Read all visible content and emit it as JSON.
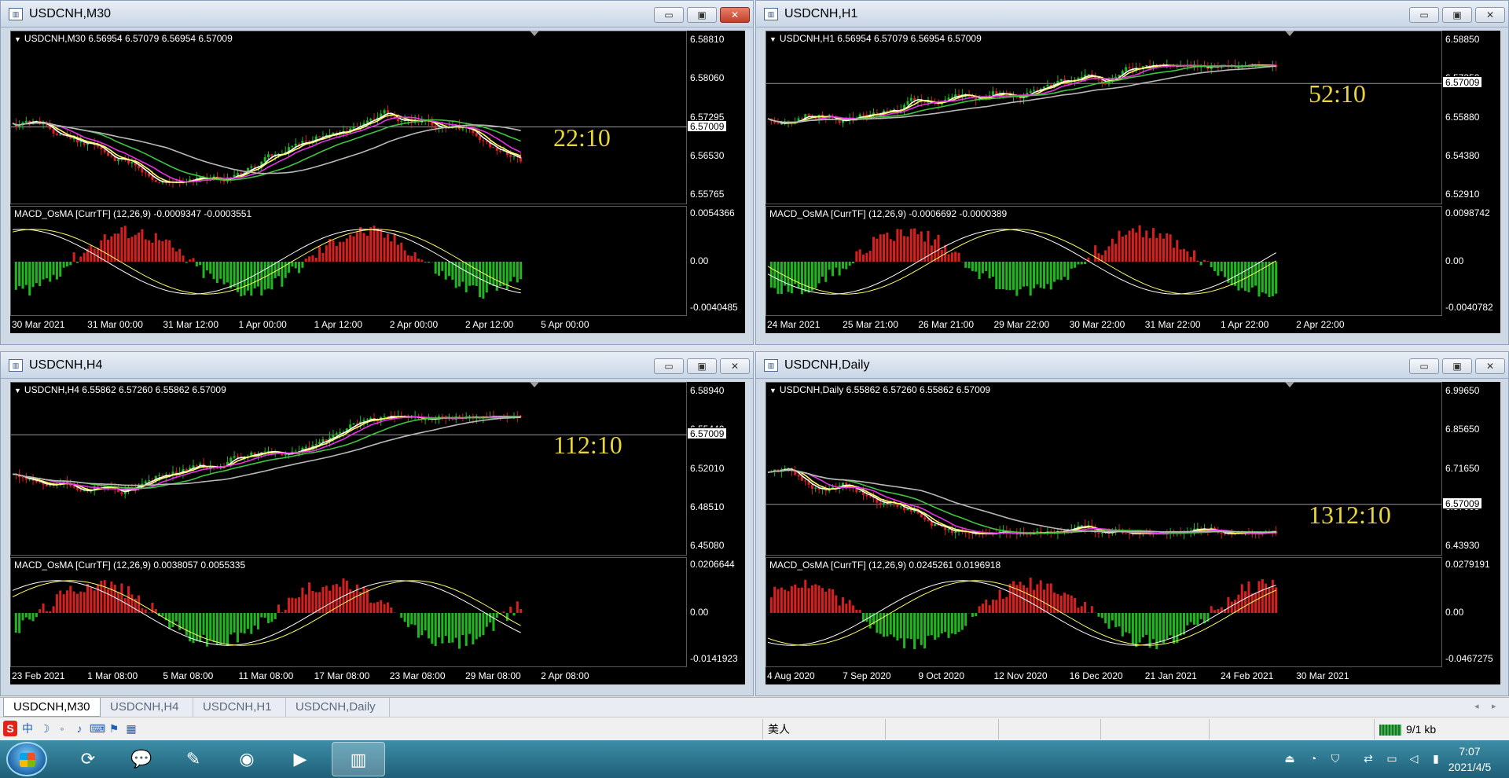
{
  "windows": [
    {
      "id": "m30",
      "title": "USDCNH,M30",
      "info": "USDCNH,M30  6.56954 6.57079 6.56954 6.57009",
      "indicator": "MACD_OsMA [CurrTF] (12,26,9) -0.0009347 -0.0003551",
      "price_axis": [
        "6.58810",
        "6.58060",
        "6.57295",
        "6.56530",
        "6.55765"
      ],
      "current_price": "6.57009",
      "ind_axis": [
        "0.0054366",
        "0.00",
        "-0.0040485"
      ],
      "time_axis": [
        "30 Mar 2021",
        "31 Mar 00:00",
        "31 Mar 12:00",
        "1 Apr 00:00",
        "1 Apr 12:00",
        "2 Apr 00:00",
        "2 Apr 12:00",
        "5 Apr 00:00"
      ],
      "countdown": "22:10",
      "seed": 11,
      "trend": "mid"
    },
    {
      "id": "h1",
      "title": "USDCNH,H1",
      "info": "USDCNH,H1  6.56954 6.57079 6.56954 6.57009",
      "indicator": "MACD_OsMA [CurrTF] (12,26,9) -0.0006692 -0.0000389",
      "price_axis": [
        "6.58850",
        "6.57350",
        "6.55880",
        "6.54380",
        "6.52910"
      ],
      "current_price": "6.57009",
      "ind_axis": [
        "0.0098742",
        "0.00",
        "-0.0040782"
      ],
      "time_axis": [
        "24 Mar 2021",
        "25 Mar 21:00",
        "26 Mar 21:00",
        "29 Mar 22:00",
        "30 Mar 22:00",
        "31 Mar 22:00",
        "1 Apr 22:00",
        "2 Apr 22:00"
      ],
      "countdown": "52:10",
      "seed": 23,
      "trend": "up"
    },
    {
      "id": "h4",
      "title": "USDCNH,H4",
      "info": "USDCNH,H4  6.55862 6.57260 6.55862 6.57009",
      "indicator": "MACD_OsMA [CurrTF] (12,26,9) 0.0038057 0.0055335",
      "price_axis": [
        "6.58940",
        "6.55440",
        "6.52010",
        "6.48510",
        "6.45080"
      ],
      "current_price": "6.57009",
      "ind_axis": [
        "0.0206644",
        "0.00",
        "-0.0141923"
      ],
      "time_axis": [
        "23 Feb 2021",
        "1 Mar 08:00",
        "5 Mar 08:00",
        "11 Mar 08:00",
        "17 Mar 08:00",
        "23 Mar 08:00",
        "29 Mar 08:00",
        "2 Apr 08:00"
      ],
      "countdown": "112:10",
      "seed": 37,
      "trend": "up"
    },
    {
      "id": "daily",
      "title": "USDCNH,Daily",
      "info": "USDCNH,Daily  6.55862 6.57260 6.55862 6.57009",
      "indicator": "MACD_OsMA [CurrTF] (12,26,9) 0.0245261 0.0196918",
      "price_axis": [
        "6.99650",
        "6.85650",
        "6.71650",
        "6.57009",
        "6.43930"
      ],
      "current_price": "6.57009",
      "ind_axis": [
        "0.0279191",
        "0.00",
        "-0.0467275"
      ],
      "time_axis": [
        "4 Aug 2020",
        "7 Sep 2020",
        "9 Oct 2020",
        "12 Nov 2020",
        "16 Dec 2020",
        "21 Jan 2021",
        "24 Feb 2021",
        "30 Mar 2021"
      ],
      "countdown": "1312:10",
      "seed": 51,
      "trend": "down"
    }
  ],
  "window_buttons": {
    "minimize": "▭",
    "maximize": "▣",
    "close": "✕"
  },
  "tabs": [
    "USDCNH,M30",
    "USDCNH,H4",
    "USDCNH,H1",
    "USDCNH,Daily"
  ],
  "active_tab": 0,
  "status": {
    "ime_label": "中",
    "profile": "美人",
    "traffic": "9/1 kb"
  },
  "taskbar": {
    "time": "7:07",
    "date": "2021/4/5"
  },
  "colors": {
    "bull": "#1fb61f",
    "bear": "#d61f1f",
    "ma_fast": "#ffff66",
    "ma_white": "#ffffff",
    "ma_magenta": "#e633e6",
    "ma_green": "#3fc43f",
    "ma_gray": "#b8b8b8",
    "countdown": "#e9d63a"
  }
}
